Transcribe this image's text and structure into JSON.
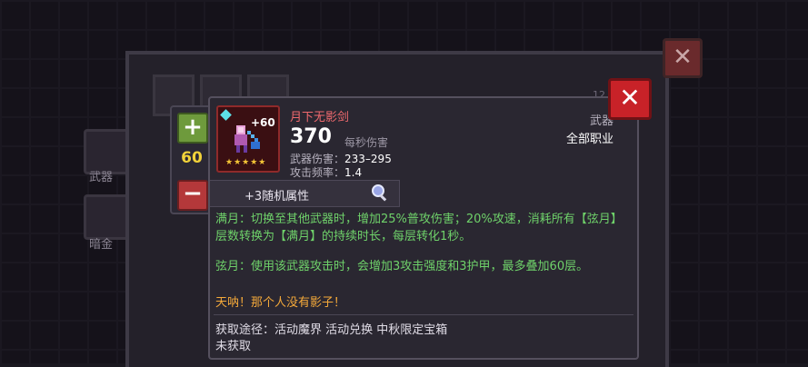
{
  "background": {
    "sidebar": {
      "weapons_label": "武器",
      "gold_label": "暗金"
    },
    "badge_count": "12"
  },
  "upgrade": {
    "level": "60"
  },
  "weapon": {
    "enchant": "+60",
    "name": "月下无影剑",
    "dps": "370",
    "dps_label": "每秒伤害",
    "damage_label": "武器伤害：",
    "damage_value": "233–295",
    "attack_speed_label": "攻击频率：",
    "attack_speed_value": "1.4",
    "category": "武器",
    "class": "全部职业",
    "random_attr": "+3随机属性",
    "effect_full_moon": "满月：切换至其他武器时，增加25%普攻伤害；20%攻速，消耗所有【弦月】层数转换为【满月】的持续时长，每层转化1秒。",
    "effect_half_moon": "弦月：使用该武器攻击时，会增加3攻击强度和3护甲，最多叠加60层。",
    "quote": "天呐！那个人没有影子！",
    "source": "获取途径：活动魔界 活动兑换 中秋限定宝箱",
    "status": "未获取"
  },
  "colors": {
    "name": "#f06a6e",
    "effect": "#6fd26a",
    "quote": "#f4a93a",
    "close": "#c82228"
  }
}
